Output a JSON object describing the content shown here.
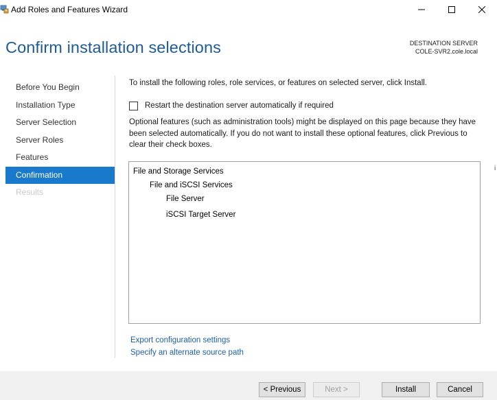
{
  "window": {
    "title": "Add Roles and Features Wizard",
    "icons": {
      "app": "server-manager-icon",
      "minimize": "minimize-icon",
      "maximize": "maximize-icon",
      "close": "close-icon"
    }
  },
  "header": {
    "page_title": "Confirm installation selections",
    "destination_label": "DESTINATION SERVER",
    "destination_server": "COLE-SVR2.cole.local"
  },
  "nav": {
    "items": [
      {
        "label": "Before You Begin",
        "state": "normal"
      },
      {
        "label": "Installation Type",
        "state": "normal"
      },
      {
        "label": "Server Selection",
        "state": "normal"
      },
      {
        "label": "Server Roles",
        "state": "normal"
      },
      {
        "label": "Features",
        "state": "normal"
      },
      {
        "label": "Confirmation",
        "state": "active"
      },
      {
        "label": "Results",
        "state": "disabled"
      }
    ]
  },
  "main": {
    "intro": "To install the following roles, role services, or features on selected server, click Install.",
    "restart_checkbox": {
      "label": "Restart the destination server automatically if required",
      "checked": false
    },
    "optional_text": "Optional features (such as administration tools) might be displayed on this page because they have been selected automatically. If you do not want to install these optional features, click Previous to clear their check boxes.",
    "selections": [
      {
        "label": "File and Storage Services",
        "level": 0
      },
      {
        "label": "File and iSCSI Services",
        "level": 1
      },
      {
        "label": "File Server",
        "level": 2
      },
      {
        "label": "iSCSI Target Server",
        "level": 2
      }
    ],
    "links": {
      "export": "Export configuration settings",
      "alternate_source": "Specify an alternate source path"
    }
  },
  "footer": {
    "previous": "< Previous",
    "next": "Next >",
    "install": "Install",
    "cancel": "Cancel"
  },
  "colors": {
    "title_blue": "#1e5a96",
    "nav_active": "#1979ca",
    "link_blue": "#1d5ea8",
    "footer_bg": "#f0f0f0"
  },
  "edge_glyph": "i"
}
